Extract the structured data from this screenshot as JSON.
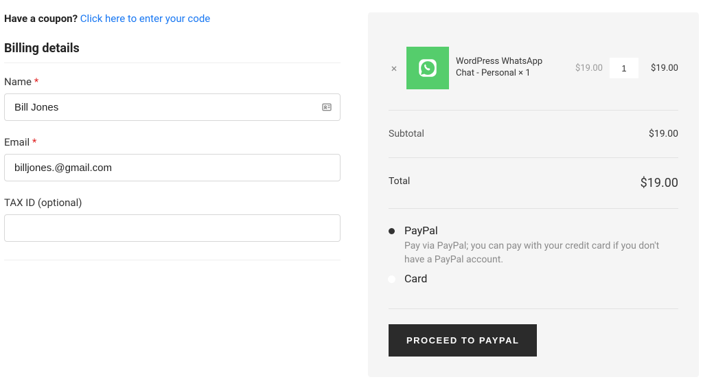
{
  "coupon": {
    "prompt": "Have a coupon?",
    "link": "Click here to enter your code"
  },
  "billing": {
    "heading": "Billing details",
    "name_label": "Name",
    "name_value": "Bill Jones",
    "email_label": "Email",
    "email_value": "billjones.@gmail.com",
    "tax_label": "TAX ID (optional)",
    "tax_value": "",
    "required_mark": "*"
  },
  "order": {
    "product_name": "WordPress WhatsApp Chat - Personal × 1",
    "unit_price": "$19.00",
    "qty": "1",
    "line_total": "$19.00",
    "subtotal_label": "Subtotal",
    "subtotal_value": "$19.00",
    "total_label": "Total",
    "total_value": "$19.00"
  },
  "payment": {
    "paypal_label": "PayPal",
    "paypal_desc": "Pay via PayPal; you can pay with your credit card if you don't have a PayPal account.",
    "card_label": "Card",
    "button": "PROCEED TO PAYPAL"
  }
}
